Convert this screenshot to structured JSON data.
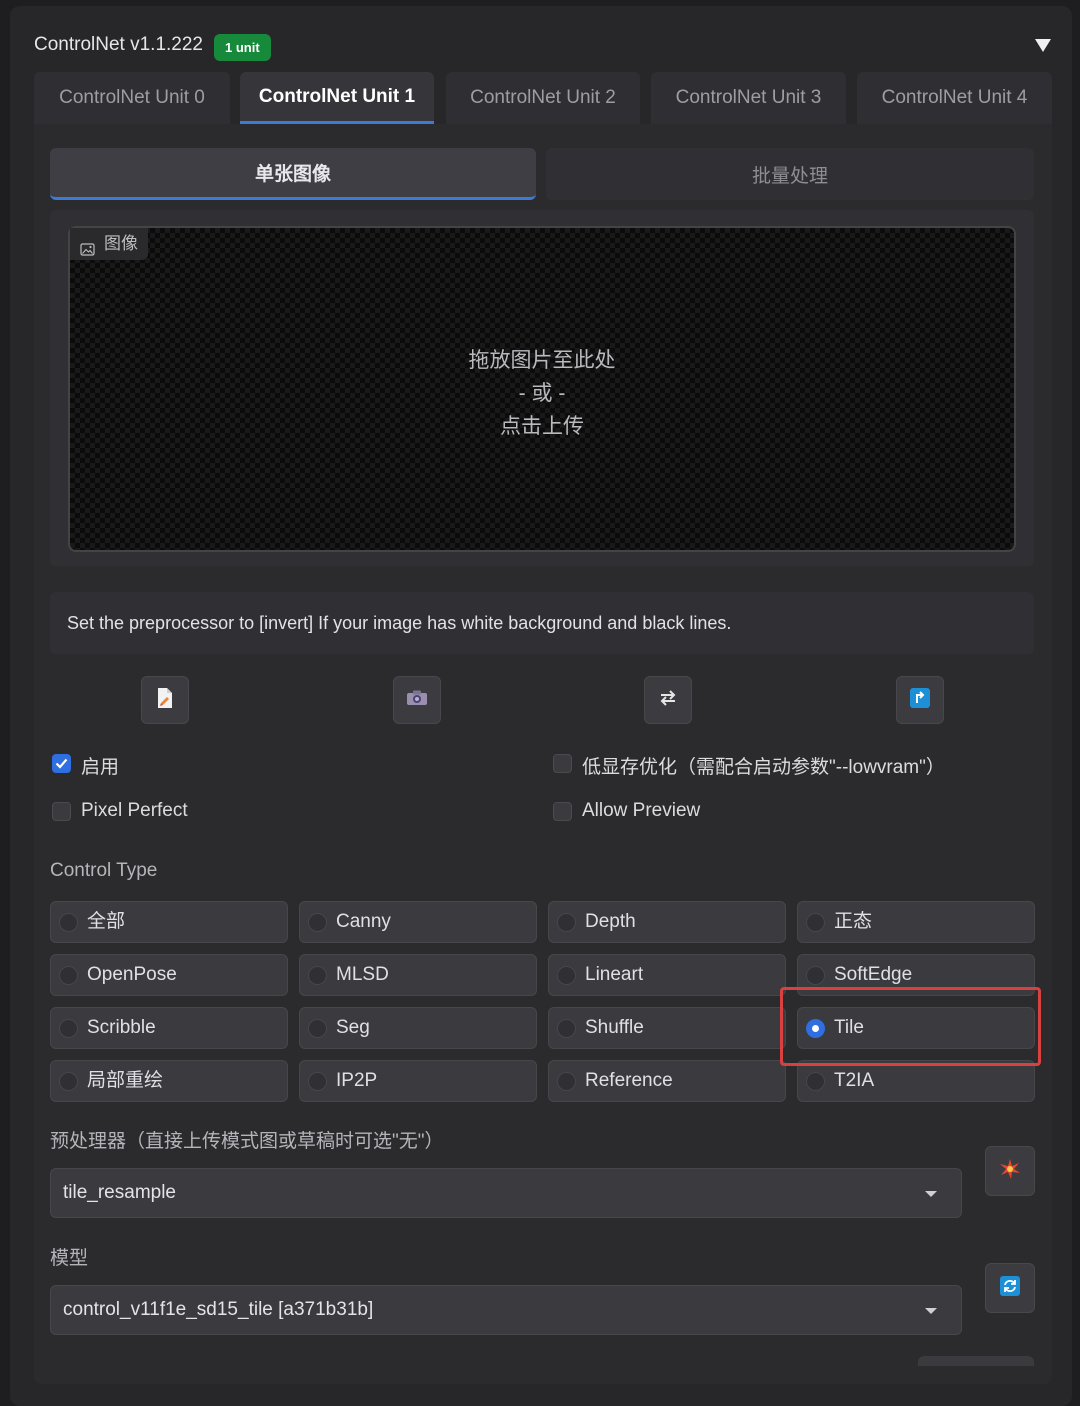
{
  "header": {
    "title": "ControlNet v1.1.222",
    "badge": "1 unit",
    "collapse_icon": "triangle-down-icon"
  },
  "unit_tabs": [
    {
      "label": "ControlNet Unit 0",
      "active": false
    },
    {
      "label": "ControlNet Unit 1",
      "active": true
    },
    {
      "label": "ControlNet Unit 2",
      "active": false
    },
    {
      "label": "ControlNet Unit 3",
      "active": false
    },
    {
      "label": "ControlNet Unit 4",
      "active": false
    }
  ],
  "mode_tabs": {
    "single": "单张图像",
    "batch": "批量处理"
  },
  "image_input": {
    "label": "图像",
    "label_icon": "image-icon",
    "line1": "拖放图片至此处",
    "line2": "- 或 -",
    "line3": "点击上传"
  },
  "hint": "Set the preprocessor to [invert] If your image has white background and black lines.",
  "tool_buttons": [
    {
      "icon": "new-canvas-icon"
    },
    {
      "icon": "camera-icon"
    },
    {
      "icon": "swap-arrows-icon"
    },
    {
      "icon": "send-dimensions-icon"
    }
  ],
  "checkboxes": {
    "enable": {
      "label": "启用",
      "checked": true
    },
    "lowvram": {
      "label": "低显存优化（需配合启动参数\"--lowvram\"）",
      "checked": false
    },
    "pixel_perfect": {
      "label": "Pixel Perfect",
      "checked": false
    },
    "allow_preview": {
      "label": "Allow Preview",
      "checked": false
    }
  },
  "control_type": {
    "label": "Control Type",
    "selected": "Tile",
    "options": [
      "全部",
      "Canny",
      "Depth",
      "正态",
      "OpenPose",
      "MLSD",
      "Lineart",
      "SoftEdge",
      "Scribble",
      "Seg",
      "Shuffle",
      "Tile",
      "局部重绘",
      "IP2P",
      "Reference",
      "T2IA"
    ]
  },
  "preprocessor": {
    "label": "预处理器（直接上传模式图或草稿时可选\"无\"）",
    "value": "tile_resample",
    "run_icon": "explosion-icon"
  },
  "model": {
    "label": "模型",
    "value": "control_v11f1e_sd15_tile [a371b31b]",
    "refresh_icon": "refresh-icon"
  },
  "colors": {
    "accent": "#2f6fe0",
    "badge": "#17893b",
    "highlight": "#d94040",
    "background": "#27272a"
  }
}
